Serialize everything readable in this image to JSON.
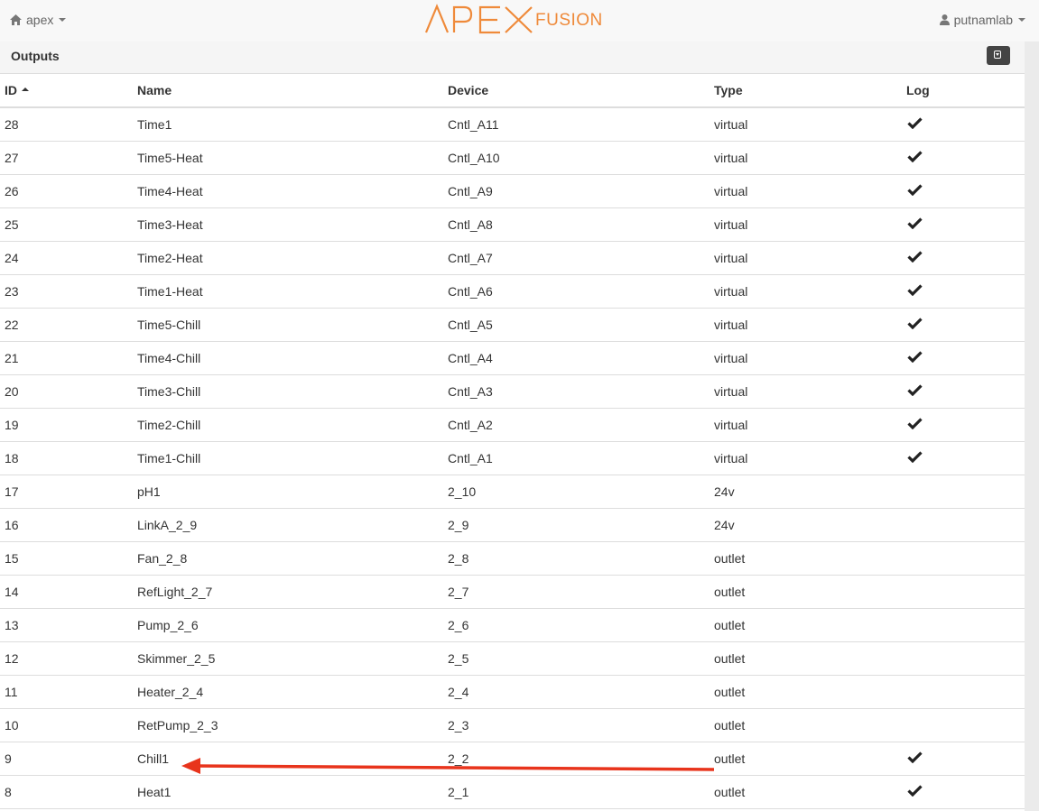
{
  "header": {
    "home_label": "apex",
    "logo_apex": "APEX",
    "logo_fusion": "FUSION",
    "user_label": "putnamlab",
    "accent_color": "#ef8a3a"
  },
  "panel": {
    "title": "Outputs"
  },
  "table": {
    "columns": [
      "ID",
      "Name",
      "Device",
      "Type",
      "Log"
    ],
    "sorted_column": "ID",
    "sort_direction": "ascending-icon",
    "rows": [
      {
        "id": "28",
        "name": "Time1",
        "device": "Cntl_A11",
        "type": "virtual",
        "log": true
      },
      {
        "id": "27",
        "name": "Time5-Heat",
        "device": "Cntl_A10",
        "type": "virtual",
        "log": true
      },
      {
        "id": "26",
        "name": "Time4-Heat",
        "device": "Cntl_A9",
        "type": "virtual",
        "log": true
      },
      {
        "id": "25",
        "name": "Time3-Heat",
        "device": "Cntl_A8",
        "type": "virtual",
        "log": true
      },
      {
        "id": "24",
        "name": "Time2-Heat",
        "device": "Cntl_A7",
        "type": "virtual",
        "log": true
      },
      {
        "id": "23",
        "name": "Time1-Heat",
        "device": "Cntl_A6",
        "type": "virtual",
        "log": true
      },
      {
        "id": "22",
        "name": "Time5-Chill",
        "device": "Cntl_A5",
        "type": "virtual",
        "log": true
      },
      {
        "id": "21",
        "name": "Time4-Chill",
        "device": "Cntl_A4",
        "type": "virtual",
        "log": true
      },
      {
        "id": "20",
        "name": "Time3-Chill",
        "device": "Cntl_A3",
        "type": "virtual",
        "log": true
      },
      {
        "id": "19",
        "name": "Time2-Chill",
        "device": "Cntl_A2",
        "type": "virtual",
        "log": true
      },
      {
        "id": "18",
        "name": "Time1-Chill",
        "device": "Cntl_A1",
        "type": "virtual",
        "log": true
      },
      {
        "id": "17",
        "name": "pH1",
        "device": "2_10",
        "type": "24v",
        "log": false
      },
      {
        "id": "16",
        "name": "LinkA_2_9",
        "device": "2_9",
        "type": "24v",
        "log": false
      },
      {
        "id": "15",
        "name": "Fan_2_8",
        "device": "2_8",
        "type": "outlet",
        "log": false
      },
      {
        "id": "14",
        "name": "RefLight_2_7",
        "device": "2_7",
        "type": "outlet",
        "log": false
      },
      {
        "id": "13",
        "name": "Pump_2_6",
        "device": "2_6",
        "type": "outlet",
        "log": false
      },
      {
        "id": "12",
        "name": "Skimmer_2_5",
        "device": "2_5",
        "type": "outlet",
        "log": false
      },
      {
        "id": "11",
        "name": "Heater_2_4",
        "device": "2_4",
        "type": "outlet",
        "log": false
      },
      {
        "id": "10",
        "name": "RetPump_2_3",
        "device": "2_3",
        "type": "outlet",
        "log": false
      },
      {
        "id": "9",
        "name": "Chill1",
        "device": "2_2",
        "type": "outlet",
        "log": true
      },
      {
        "id": "8",
        "name": "Heat1",
        "device": "2_1",
        "type": "outlet",
        "log": true
      }
    ]
  },
  "annotation": {
    "arrow_color": "#e8341c",
    "points_to": "Chill1"
  }
}
